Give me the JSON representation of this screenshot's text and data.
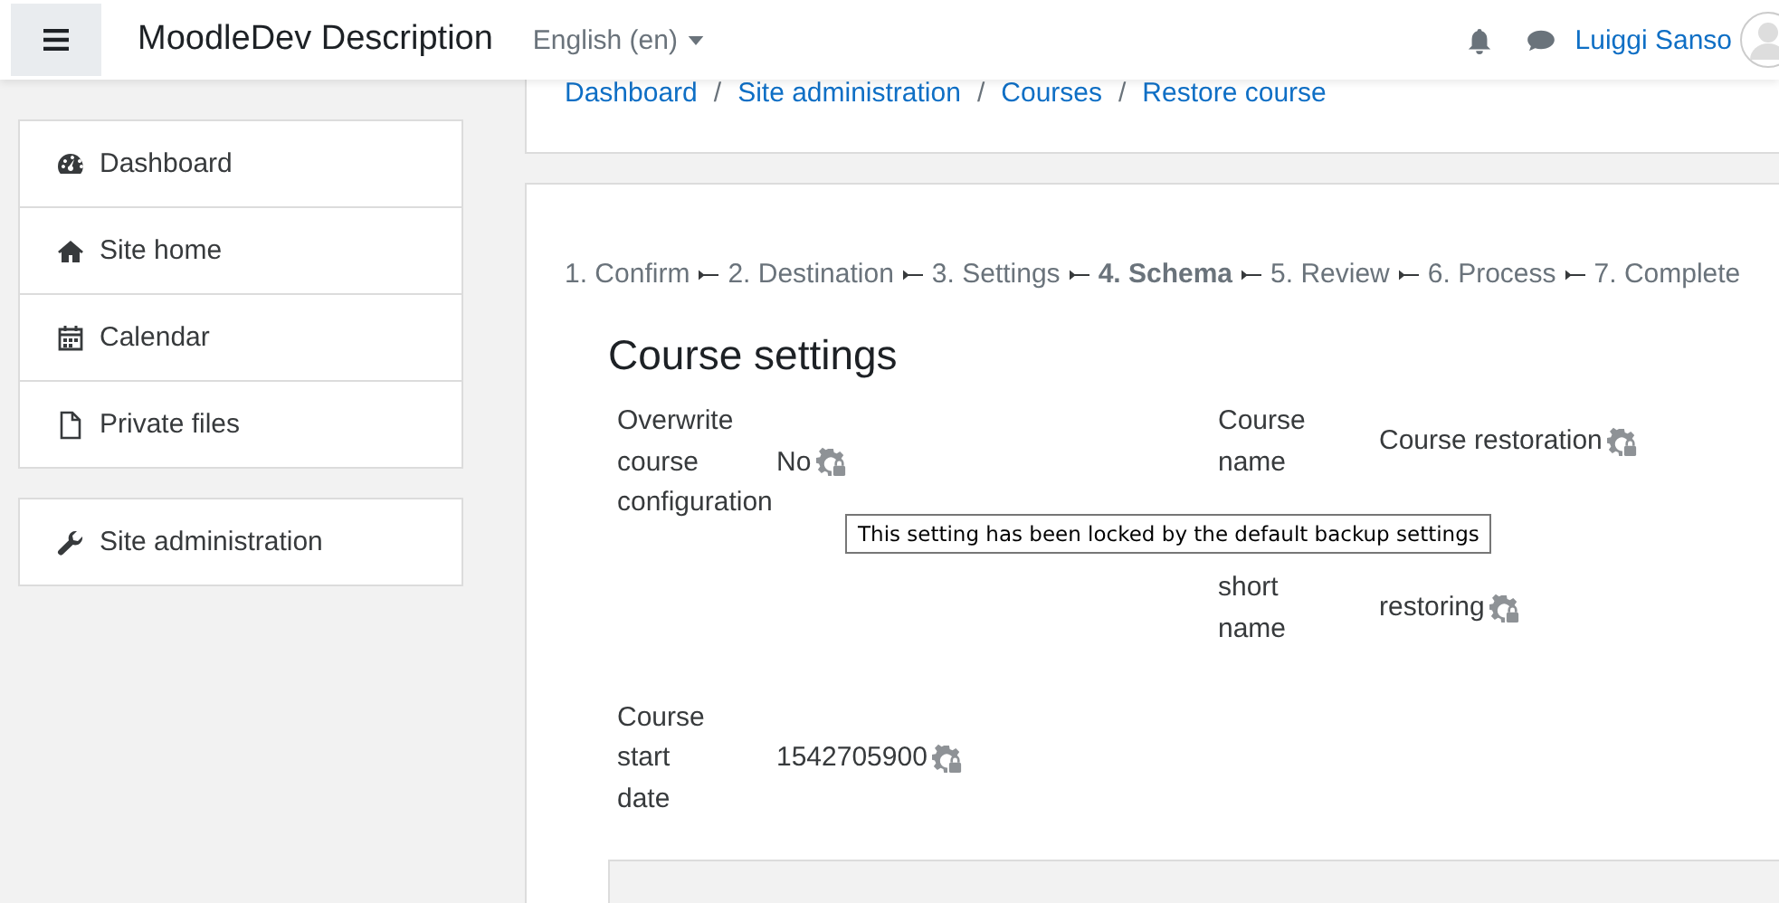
{
  "header": {
    "site_name": "MoodleDev Description",
    "language": "English (en)",
    "user_name": "Luiggi Sanso"
  },
  "sidebar": {
    "groups": [
      [
        "Dashboard",
        "Site home",
        "Calendar",
        "Private files"
      ],
      [
        "Site administration"
      ]
    ]
  },
  "breadcrumb": [
    {
      "label": "Dashboard"
    },
    {
      "separator": "/",
      "label": "Site administration"
    },
    {
      "separator": "/",
      "label": "Courses"
    },
    {
      "separator": "/",
      "label": "Restore course"
    }
  ],
  "steps": [
    {
      "label": "1. Confirm",
      "selected": false
    },
    {
      "label": "2. Destination",
      "selected": false
    },
    {
      "label": "3. Settings",
      "selected": false
    },
    {
      "label": "4. Schema",
      "selected": true
    },
    {
      "label": "5. Review",
      "selected": false
    },
    {
      "label": "6. Process",
      "selected": false
    },
    {
      "label": "7. Complete",
      "selected": false
    }
  ],
  "section_title": "Course settings",
  "left_fields": [
    {
      "label": "Overwrite course configuration",
      "value": "No",
      "locked": true
    },
    {
      "label": "Course start date",
      "value": "1542705900",
      "locked": true
    }
  ],
  "right_fields": [
    {
      "label": "Course name",
      "value": "Course restoration",
      "locked": true
    },
    {
      "label": "short name",
      "value": "restoring",
      "locked": true
    }
  ],
  "tooltip": "This setting has been locked by the default backup settings"
}
